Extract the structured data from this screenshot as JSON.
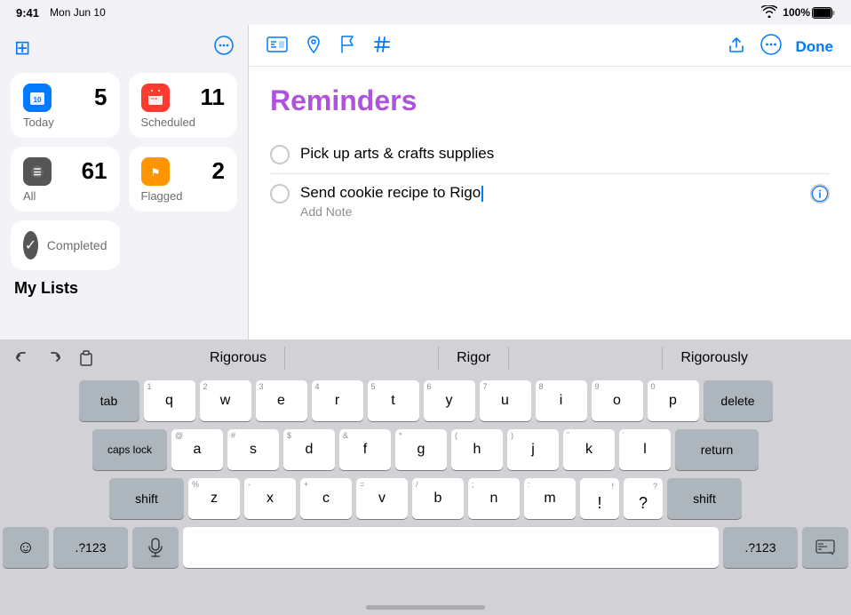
{
  "statusBar": {
    "time": "9:41",
    "date": "Mon Jun 10",
    "wifiIcon": "📶",
    "batteryLevel": "100%"
  },
  "sidebar": {
    "smartLists": [
      {
        "id": "today",
        "label": "Today",
        "count": "5",
        "iconSymbol": "📅",
        "iconClass": "icon-today"
      },
      {
        "id": "scheduled",
        "label": "Scheduled",
        "count": "11",
        "iconSymbol": "📋",
        "iconClass": "icon-scheduled"
      },
      {
        "id": "all",
        "label": "All",
        "count": "61",
        "iconSymbol": "☰",
        "iconClass": "icon-all"
      },
      {
        "id": "flagged",
        "label": "Flagged",
        "count": "2",
        "iconSymbol": "⚑",
        "iconClass": "icon-flagged"
      }
    ],
    "completed": {
      "label": "Completed",
      "iconSymbol": "✓"
    },
    "myListsLabel": "My Lists"
  },
  "toolbar": {
    "icons": [
      "🗂",
      "➤",
      "⚑",
      "#"
    ],
    "shareLabel": "share",
    "moreLabel": "•••",
    "doneLabel": "Done"
  },
  "reminders": {
    "title": "Reminders",
    "items": [
      {
        "id": "item1",
        "text": "Pick up arts & crafts supplies",
        "hasInfo": false
      },
      {
        "id": "item2",
        "text": "Send cookie recipe to Rigo",
        "note": "Add Note",
        "hasInfo": true,
        "active": true
      }
    ]
  },
  "predictive": {
    "tools": [
      "↩",
      "↪",
      "📋"
    ],
    "suggestions": [
      "Rigorous",
      "Rigor",
      "Rigorously"
    ]
  },
  "keyboard": {
    "row1": [
      {
        "key": "q",
        "num": "1"
      },
      {
        "key": "w",
        "num": "2"
      },
      {
        "key": "e",
        "num": "3"
      },
      {
        "key": "r",
        "num": "4"
      },
      {
        "key": "t",
        "num": "5"
      },
      {
        "key": "y",
        "num": "6"
      },
      {
        "key": "u",
        "num": "7"
      },
      {
        "key": "i",
        "num": "8"
      },
      {
        "key": "o",
        "num": "9"
      },
      {
        "key": "p",
        "num": "0"
      }
    ],
    "row2": [
      {
        "key": "a",
        "num": "@"
      },
      {
        "key": "s",
        "num": "#"
      },
      {
        "key": "d",
        "num": "$"
      },
      {
        "key": "f",
        "num": "&"
      },
      {
        "key": "g",
        "num": "*"
      },
      {
        "key": "h",
        "num": "("
      },
      {
        "key": "j",
        "num": ")"
      },
      {
        "key": "k",
        "num": "\""
      },
      {
        "key": "l",
        "num": "'"
      }
    ],
    "row3": [
      {
        "key": "z",
        "num": "%"
      },
      {
        "key": "x",
        "num": "-"
      },
      {
        "key": "c",
        "num": "+"
      },
      {
        "key": "v",
        "num": "="
      },
      {
        "key": "b",
        "num": "/"
      },
      {
        "key": "n",
        "num": ";"
      },
      {
        "key": "m",
        "num": ":"
      }
    ],
    "specialKeys": {
      "tab": "tab",
      "capsLock": "caps lock",
      "shift": "shift",
      "delete": "delete",
      "return": "return",
      "emoji": "☺",
      "numbers": ".?123",
      "mic": "🎤",
      "numbersRight": ".?123",
      "keyboard": "⌨"
    }
  }
}
